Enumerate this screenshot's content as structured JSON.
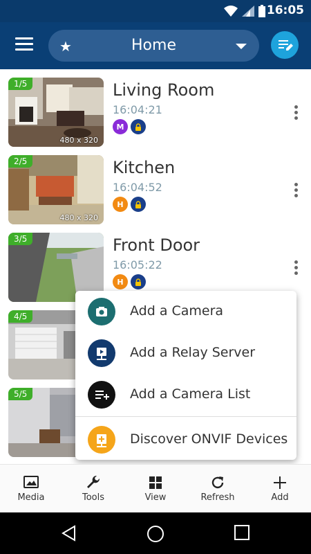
{
  "status": {
    "time": "16:05"
  },
  "appbar": {
    "title": "Home"
  },
  "cameras": [
    {
      "index": "1/5",
      "name": "Living Room",
      "time": "16:04:21",
      "resolution": "480 x 320",
      "badge": "M",
      "badge_color": "#8a2bd8"
    },
    {
      "index": "2/5",
      "name": "Kitchen",
      "time": "16:04:52",
      "resolution": "480 x 320",
      "badge": "H",
      "badge_color": "#f28a12"
    },
    {
      "index": "3/5",
      "name": "Front Door",
      "time": "16:05:22",
      "resolution": "480",
      "badge": "H",
      "badge_color": "#f28a12"
    },
    {
      "index": "4/5",
      "resolution": "480"
    },
    {
      "index": "5/5",
      "resolution": "480"
    }
  ],
  "add_menu": [
    {
      "label": "Add a Camera",
      "icon": "camera-icon",
      "color": "#1c6e70"
    },
    {
      "label": "Add a Relay Server",
      "icon": "relay-server-icon",
      "color": "#123a6e"
    },
    {
      "label": "Add a Camera List",
      "icon": "playlist-add-icon",
      "color": "#111111"
    },
    {
      "label": "Discover ONVIF Devices",
      "icon": "discover-device-icon",
      "color": "#f5a51a"
    }
  ],
  "bottom_nav": [
    {
      "label": "Media",
      "icon": "media-icon"
    },
    {
      "label": "Tools",
      "icon": "wrench-icon"
    },
    {
      "label": "View",
      "icon": "grid-icon"
    },
    {
      "label": "Refresh",
      "icon": "refresh-icon"
    },
    {
      "label": "Add",
      "icon": "plus-icon"
    }
  ]
}
